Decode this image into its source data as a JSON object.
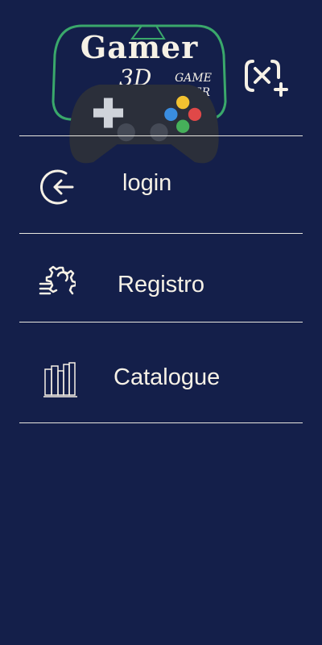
{
  "app": {
    "logo": {
      "title": "Gamer",
      "subtitle": "3D",
      "tagline_line1": "GAME",
      "tagline_line2": "OVER"
    },
    "close_icon": "close-plus-icon"
  },
  "menu": {
    "items": [
      {
        "label": "login",
        "icon": "login-icon"
      },
      {
        "label": "Registro",
        "icon": "settings-list-icon"
      },
      {
        "label": "Catalogue",
        "icon": "books-icon"
      }
    ]
  },
  "colors": {
    "background": "#141f4a",
    "text": "#f6f1e6",
    "logo_outline": "#3aa86b",
    "divider": "#e8e6df"
  }
}
